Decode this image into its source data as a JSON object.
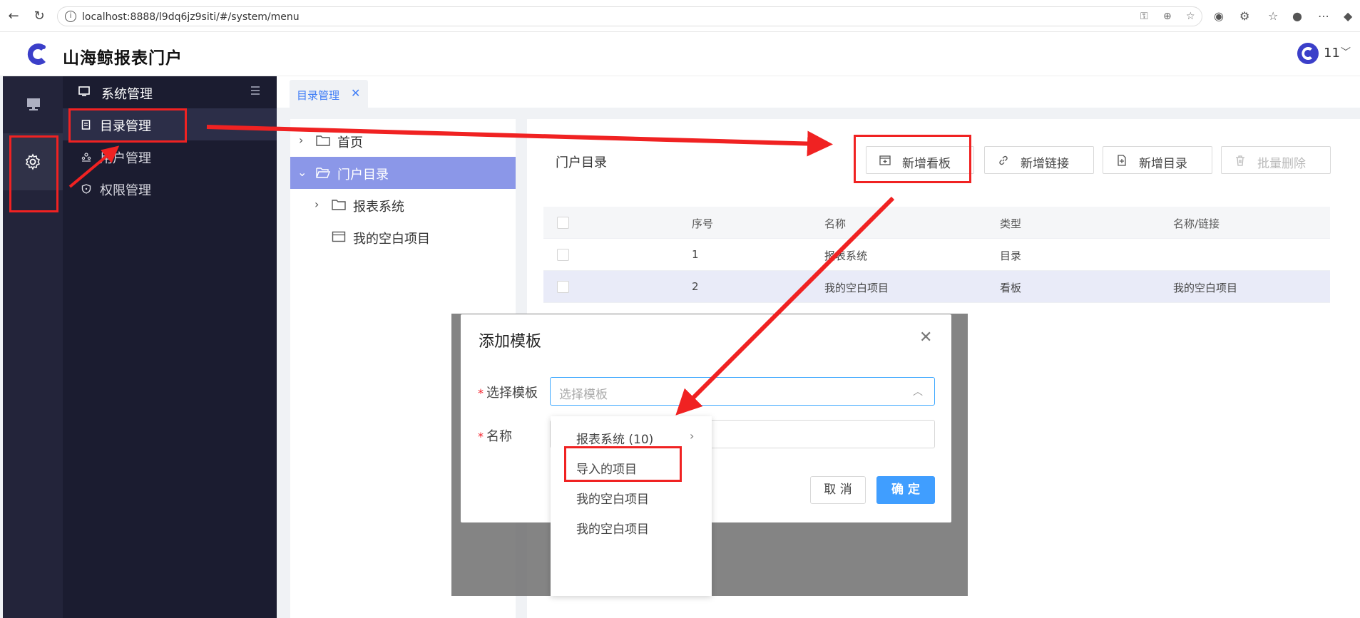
{
  "browser": {
    "url": "localhost:8888/l9dq6jz9siti/#/system/menu"
  },
  "app": {
    "title": "山海鲸报表门户",
    "user": "11"
  },
  "menu": {
    "section_title": "系统管理",
    "items": [
      {
        "label": "目录管理"
      },
      {
        "label": "用户管理"
      },
      {
        "label": "权限管理"
      }
    ]
  },
  "tabs": [
    {
      "label": "目录管理"
    }
  ],
  "tree": {
    "nodes": [
      {
        "label": "首页"
      },
      {
        "label": "门户目录"
      },
      {
        "label": "报表系统"
      },
      {
        "label": "我的空白项目"
      }
    ]
  },
  "content": {
    "title": "门户目录",
    "buttons": {
      "add_board": "新增看板",
      "add_link": "新增链接",
      "add_dir": "新增目录",
      "batch_delete": "批量删除"
    },
    "table": {
      "headers": [
        "序号",
        "名称",
        "类型",
        "名称/链接"
      ],
      "rows": [
        {
          "index": "1",
          "name": "报表系统",
          "type": "目录",
          "link": ""
        },
        {
          "index": "2",
          "name": "我的空白项目",
          "type": "看板",
          "link": "我的空白项目"
        }
      ]
    }
  },
  "dialog": {
    "title": "添加模板",
    "template_label": "选择模板",
    "template_placeholder": "选择模板",
    "name_label": "名称",
    "cancel": "取 消",
    "ok": "确 定"
  },
  "dropdown": {
    "options": [
      {
        "label": "报表系统 (10)"
      },
      {
        "label": "导入的项目"
      },
      {
        "label": "我的空白项目"
      },
      {
        "label": "我的空白项目"
      }
    ]
  },
  "colors": {
    "accent": "#409eff",
    "sidebar": "#1b1c30",
    "selected_tree": "#8b97e8",
    "annotation": "#f02222"
  }
}
